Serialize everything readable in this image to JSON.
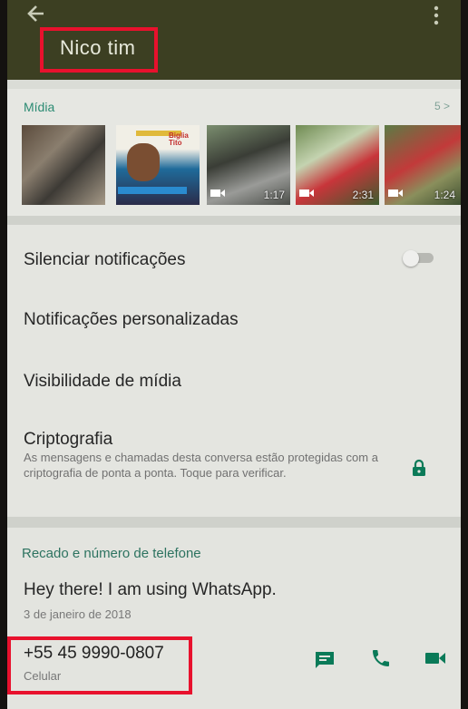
{
  "header": {
    "title": "Nico tim"
  },
  "media": {
    "label": "Mídia",
    "count": "5 >",
    "thumbnails": [
      {
        "kind": "image",
        "duration": ""
      },
      {
        "kind": "image",
        "duration": "",
        "overlay_text": "Biglia Tito"
      },
      {
        "kind": "video",
        "duration": "1:17"
      },
      {
        "kind": "video",
        "duration": "2:31"
      },
      {
        "kind": "video",
        "duration": "1:24"
      }
    ]
  },
  "settings": {
    "mute": {
      "label": "Silenciar notificações",
      "enabled": false
    },
    "custom_notifications": "Notificações personalizadas",
    "media_visibility": "Visibilidade de mídia",
    "encryption": {
      "label": "Criptografia",
      "description": "As mensagens e chamadas desta conversa estão protegidas com a criptografia de ponta a ponta. Toque para verificar."
    }
  },
  "about": {
    "label": "Recado e número de telefone",
    "status": "Hey there! I am using WhatsApp.",
    "date": "3 de janeiro de 2018",
    "phone": "+55 45 9990-0807",
    "phone_type": "Celular"
  },
  "colors": {
    "accent": "#075e54",
    "highlight_box": "#e8112d",
    "header_bg": "#3c3f22"
  },
  "icons": [
    "back-arrow-icon",
    "more-vert-icon",
    "video-camera-icon",
    "lock-icon",
    "message-icon",
    "phone-icon",
    "video-call-icon"
  ]
}
